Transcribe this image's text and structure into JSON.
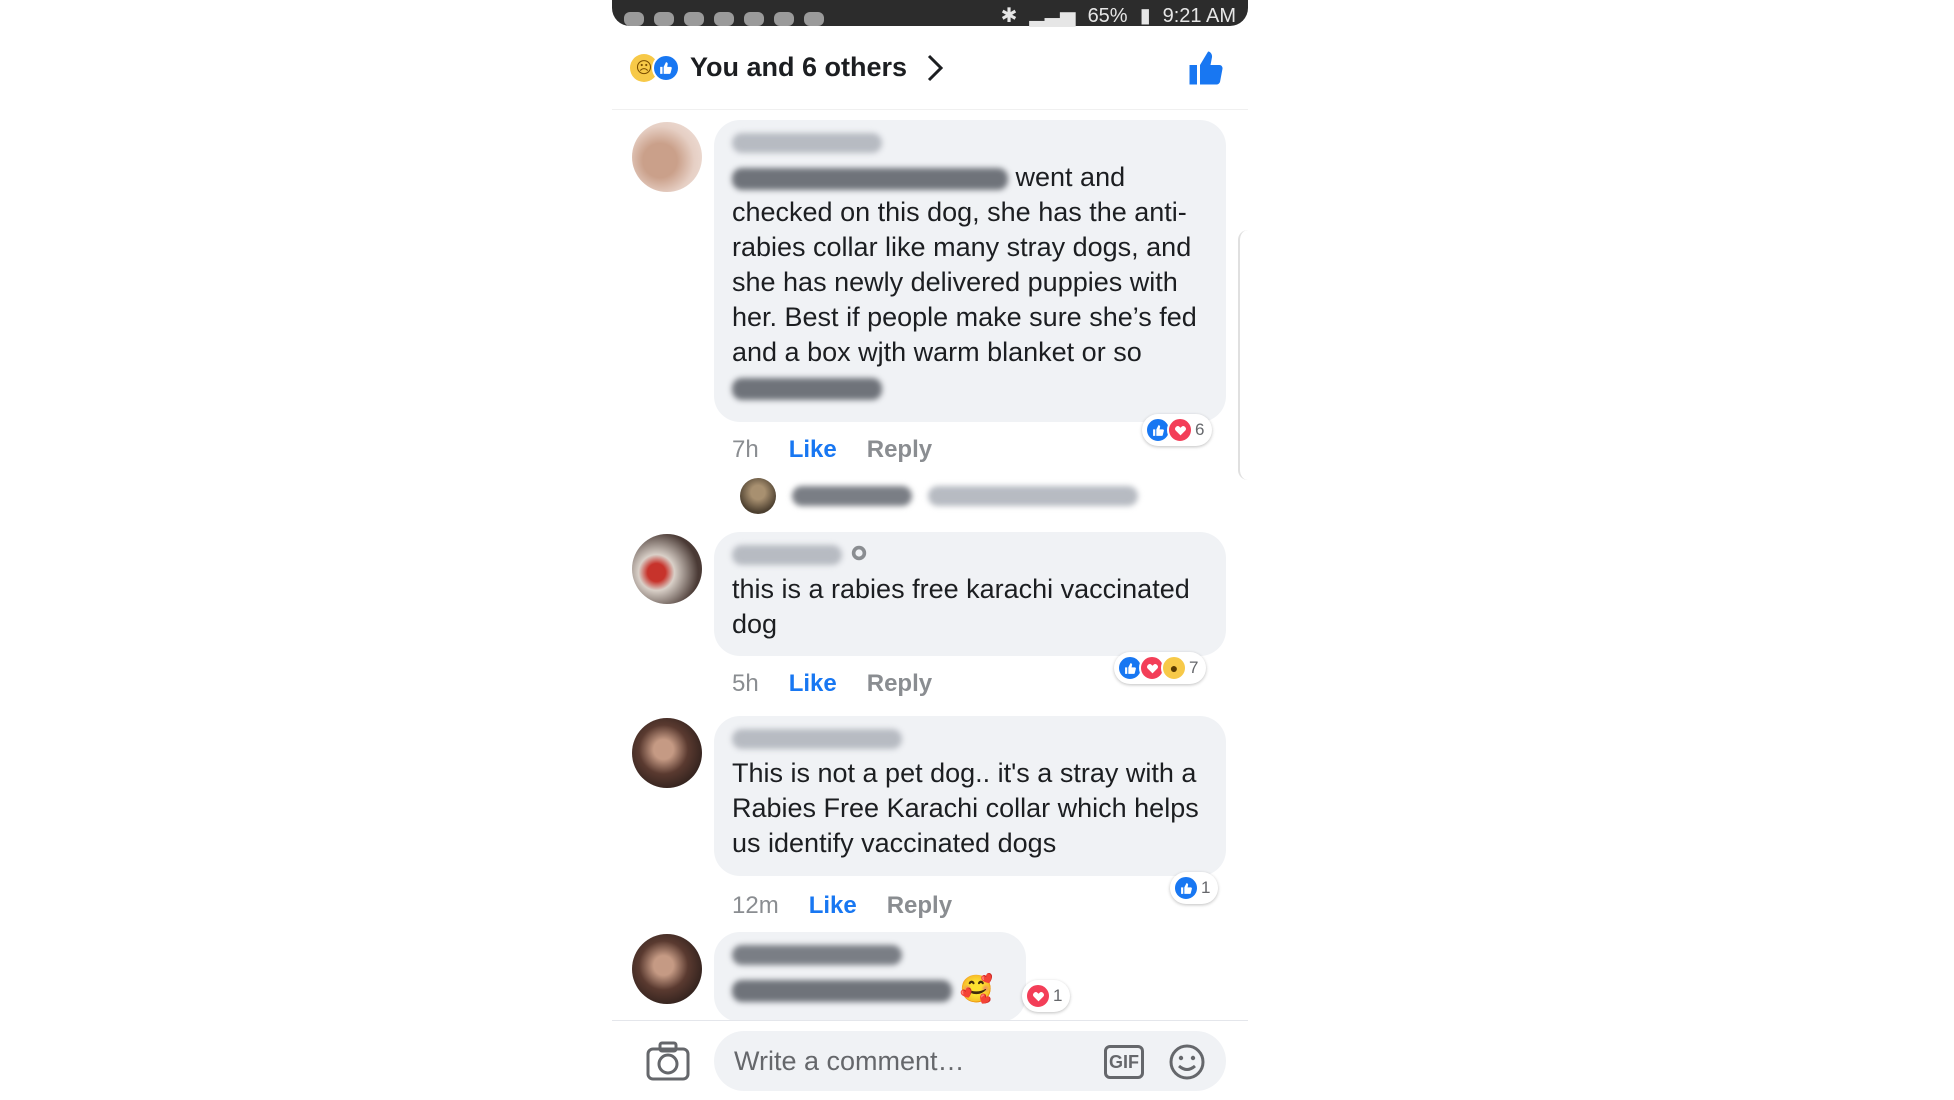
{
  "status_bar": {
    "battery": "65%",
    "time": "9:21 AM"
  },
  "header": {
    "title": "You and 6 others",
    "icons": [
      "sad-reaction-icon",
      "like-reaction-icon",
      "chevron-right-icon",
      "thumbs-up-icon"
    ]
  },
  "comments": [
    {
      "text": "went and checked on this dog, she has the anti-rabies collar like many stray dogs, and she has newly delivered puppies with her. Best if people make sure she’s fed and a box wjth warm blanket or so",
      "time": "7h",
      "like_label": "Like",
      "reply_label": "Reply",
      "reaction_count": "6"
    },
    {
      "text": "this is a rabies free karachi vaccinated dog",
      "time": "5h",
      "like_label": "Like",
      "reply_label": "Reply",
      "reaction_count": "7"
    },
    {
      "text": "This is not a pet dog.. it's a stray with a Rabies Free Karachi collar which helps us identify vaccinated dogs",
      "time": "12m",
      "like_label": "Like",
      "reply_label": "Reply",
      "reaction_count": "1"
    },
    {
      "text": "🥰",
      "reaction_count": "1"
    }
  ],
  "composer": {
    "placeholder": "Write a comment…",
    "gif_label": "GIF"
  },
  "colors": {
    "accent": "#1877f2",
    "bubble": "#f0f2f5",
    "love": "#f33e58"
  }
}
